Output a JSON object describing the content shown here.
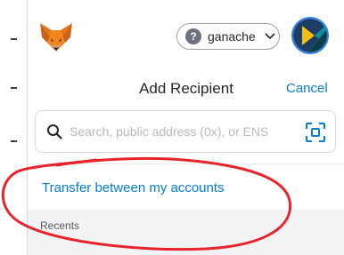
{
  "header": {
    "logo_icon": "metamask-fox-icon",
    "network": {
      "label": "ganache",
      "status_icon": "question-mark-icon",
      "status_symbol": "?",
      "dropdown_icon": "chevron-down-icon"
    },
    "account_icon": "account-identicon"
  },
  "send": {
    "title": "Add Recipient",
    "cancel_label": "Cancel"
  },
  "search": {
    "placeholder": "Search, public address (0x), or ENS",
    "value": "",
    "search_icon": "search-icon",
    "scan_icon": "qr-scan-icon"
  },
  "transfer": {
    "label": "Transfer between my accounts"
  },
  "recents": {
    "label": "Recents"
  },
  "annotation": {
    "color": "#e8242a",
    "shape": "hand-drawn-ellipse"
  },
  "colors": {
    "link": "#037dd6",
    "text": "#24272a",
    "avatar_ring": "#2f80ed"
  }
}
